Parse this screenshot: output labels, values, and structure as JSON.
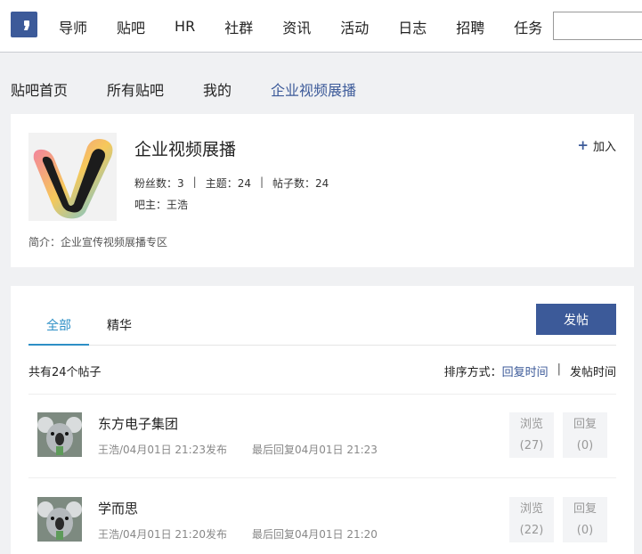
{
  "nav": {
    "items": [
      "导师",
      "贴吧",
      "HR",
      "社群",
      "资讯",
      "活动",
      "日志",
      "招聘",
      "任务"
    ],
    "search_value": ""
  },
  "subnav": {
    "items": [
      "贴吧首页",
      "所有贴吧",
      "我的",
      "企业视频展播"
    ],
    "active_index": 3
  },
  "forum": {
    "name": "企业视频展播",
    "join_label": "加入",
    "fans_label": "粉丝数：3",
    "topics_label": "主题：24",
    "posts_label": "帖子数：24",
    "owner_label": "吧主：王浩",
    "intro": "简介：企业宣传视频展播专区"
  },
  "posts_panel": {
    "tabs": [
      "全部",
      "精华"
    ],
    "post_button": "发帖",
    "total": "共有24个帖子",
    "sort_label": "排序方式：",
    "sort_options": [
      "回复时间",
      "发帖时间"
    ],
    "items": [
      {
        "title": "东方电子集团",
        "posted": "王浩/04月01日 21:23发布",
        "last_reply": "最后回复04月01日 21:23",
        "views_label": "浏览",
        "views": "(27)",
        "replies_label": "回复",
        "replies": "(0)"
      },
      {
        "title": "学而思",
        "posted": "王浩/04月01日 21:20发布",
        "last_reply": "最后回复04月01日 21:20",
        "views_label": "浏览",
        "views": "(22)",
        "replies_label": "回复",
        "replies": "(0)"
      }
    ]
  },
  "colors": {
    "brand": "#3c5a99",
    "tab_active": "#2d8fc6"
  }
}
